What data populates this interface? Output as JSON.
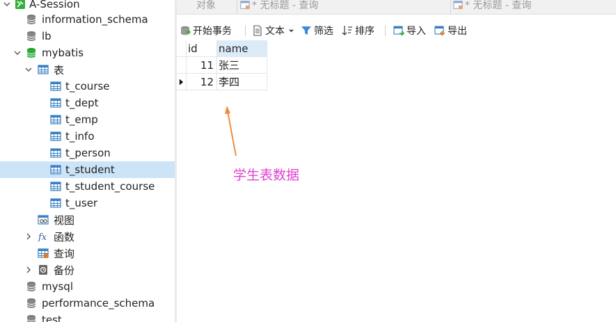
{
  "sidebar": {
    "items": [
      {
        "label": "A-Session",
        "icon": "connection-icon",
        "expanded": true
      },
      {
        "label": "information_schema",
        "icon": "database-icon"
      },
      {
        "label": "lb",
        "icon": "database-icon"
      },
      {
        "label": "mybatis",
        "icon": "database-active-icon",
        "expanded": true
      },
      {
        "label": "表",
        "icon": "tables-folder-icon",
        "expanded": true
      },
      {
        "label": "t_course",
        "icon": "table-icon"
      },
      {
        "label": "t_dept",
        "icon": "table-icon"
      },
      {
        "label": "t_emp",
        "icon": "table-icon"
      },
      {
        "label": "t_info",
        "icon": "table-icon"
      },
      {
        "label": "t_person",
        "icon": "table-icon"
      },
      {
        "label": "t_student",
        "icon": "table-icon",
        "selected": true
      },
      {
        "label": "t_student_course",
        "icon": "table-icon"
      },
      {
        "label": "t_user",
        "icon": "table-icon"
      },
      {
        "label": "视图",
        "icon": "view-icon"
      },
      {
        "label": "函数",
        "icon": "function-icon",
        "collapsed": true
      },
      {
        "label": "查询",
        "icon": "query-icon"
      },
      {
        "label": "备份",
        "icon": "backup-icon",
        "collapsed": true
      },
      {
        "label": "mysql",
        "icon": "database-icon"
      },
      {
        "label": "performance_schema",
        "icon": "database-icon"
      },
      {
        "label": "test",
        "icon": "database-icon"
      }
    ]
  },
  "tabs": [
    {
      "label": "对象"
    },
    {
      "label": "* 无标题 - 查询",
      "icon": "query-tab-icon"
    },
    {
      "label": "* 无标题 - 查询",
      "icon": "query-tab-icon"
    }
  ],
  "toolbar": {
    "begin_transaction": "开始事务",
    "text": "文本",
    "filter": "筛选",
    "sort": "排序",
    "import": "导入",
    "export": "导出"
  },
  "grid": {
    "columns": [
      "id",
      "name"
    ],
    "rows": [
      {
        "id": "11",
        "name": "张三"
      },
      {
        "id": "12",
        "name": "李四"
      }
    ]
  },
  "annotation": "学生表数据",
  "colors": {
    "selection": "#cce4f7",
    "active_db": "#2fae3b",
    "annotation_text": "#e040d0",
    "arrow": "#f08a3c",
    "header_active": "#dcebf8"
  }
}
